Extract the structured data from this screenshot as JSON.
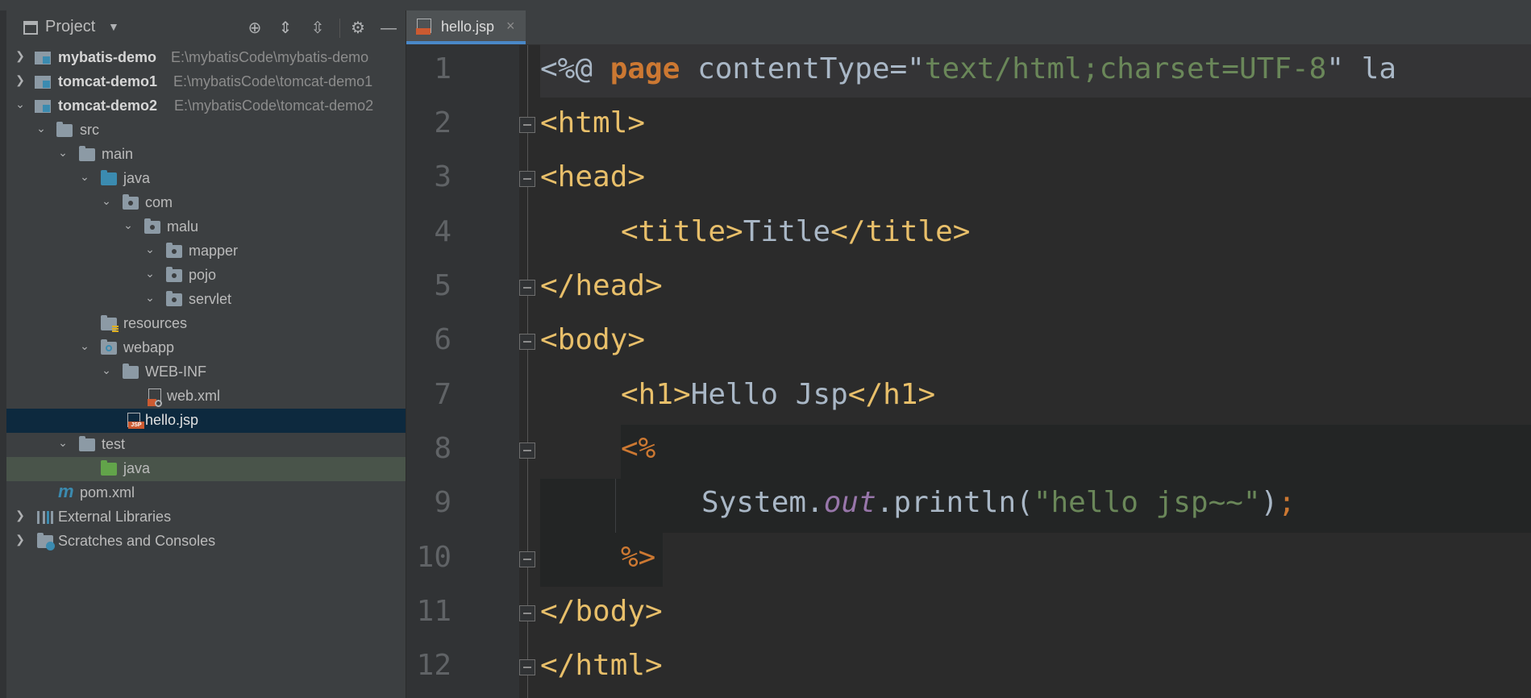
{
  "project_panel": {
    "title": "Project",
    "tree": [
      {
        "label": "mybatis-demo",
        "path": "E:\\mybatisCode\\mybatis-demo",
        "kind": "module",
        "expanded": false
      },
      {
        "label": "tomcat-demo1",
        "path": "E:\\mybatisCode\\tomcat-demo1",
        "kind": "module",
        "expanded": false
      },
      {
        "label": "tomcat-demo2",
        "path": "E:\\mybatisCode\\tomcat-demo2",
        "kind": "module",
        "expanded": true
      },
      {
        "label": "src",
        "kind": "folder"
      },
      {
        "label": "main",
        "kind": "folder"
      },
      {
        "label": "java",
        "kind": "source-folder"
      },
      {
        "label": "com",
        "kind": "package"
      },
      {
        "label": "malu",
        "kind": "package"
      },
      {
        "label": "mapper",
        "kind": "package"
      },
      {
        "label": "pojo",
        "kind": "package"
      },
      {
        "label": "servlet",
        "kind": "package"
      },
      {
        "label": "resources",
        "kind": "resources-folder"
      },
      {
        "label": "webapp",
        "kind": "web-folder"
      },
      {
        "label": "WEB-INF",
        "kind": "folder"
      },
      {
        "label": "web.xml",
        "kind": "xml-file"
      },
      {
        "label": "hello.jsp",
        "kind": "jsp-file",
        "selected": true
      },
      {
        "label": "test",
        "kind": "folder"
      },
      {
        "label": "java",
        "kind": "test-source-folder"
      },
      {
        "label": "pom.xml",
        "kind": "maven-file"
      },
      {
        "label": "External Libraries",
        "kind": "libraries"
      },
      {
        "label": "Scratches and Consoles",
        "kind": "scratches"
      }
    ]
  },
  "editor": {
    "tab": {
      "label": "hello.jsp",
      "close": "×"
    },
    "line_numbers": [
      "1",
      "2",
      "3",
      "4",
      "5",
      "6",
      "7",
      "8",
      "9",
      "10",
      "11",
      "12"
    ],
    "lines": {
      "l1": {
        "a": "<%@ ",
        "b": "page",
        "c": " contentType=\"",
        "d": "text/html;charset=UTF-8",
        "e": "\" la"
      },
      "l2": "<html>",
      "l3": "<head>",
      "l4": {
        "open": "<title>",
        "text": "Title",
        "close": "</title>"
      },
      "l5": "</head>",
      "l6": "<body>",
      "l7": {
        "open": "<h1>",
        "text": "Hello Jsp",
        "close": "</h1>"
      },
      "l8": "<%",
      "l9": {
        "obj": "System.",
        "field": "out",
        "call": ".println(",
        "str": "\"hello jsp~~\"",
        "end": ")",
        "semi": ";"
      },
      "l10": "%>",
      "l11": "</body>",
      "l12": "</html>"
    }
  },
  "colors": {
    "tag": "#e8bf6a",
    "keyword": "#cc7832",
    "string": "#6a8759",
    "field": "#9876aa",
    "text": "#a9b7c6",
    "selection": "#0d293e"
  }
}
